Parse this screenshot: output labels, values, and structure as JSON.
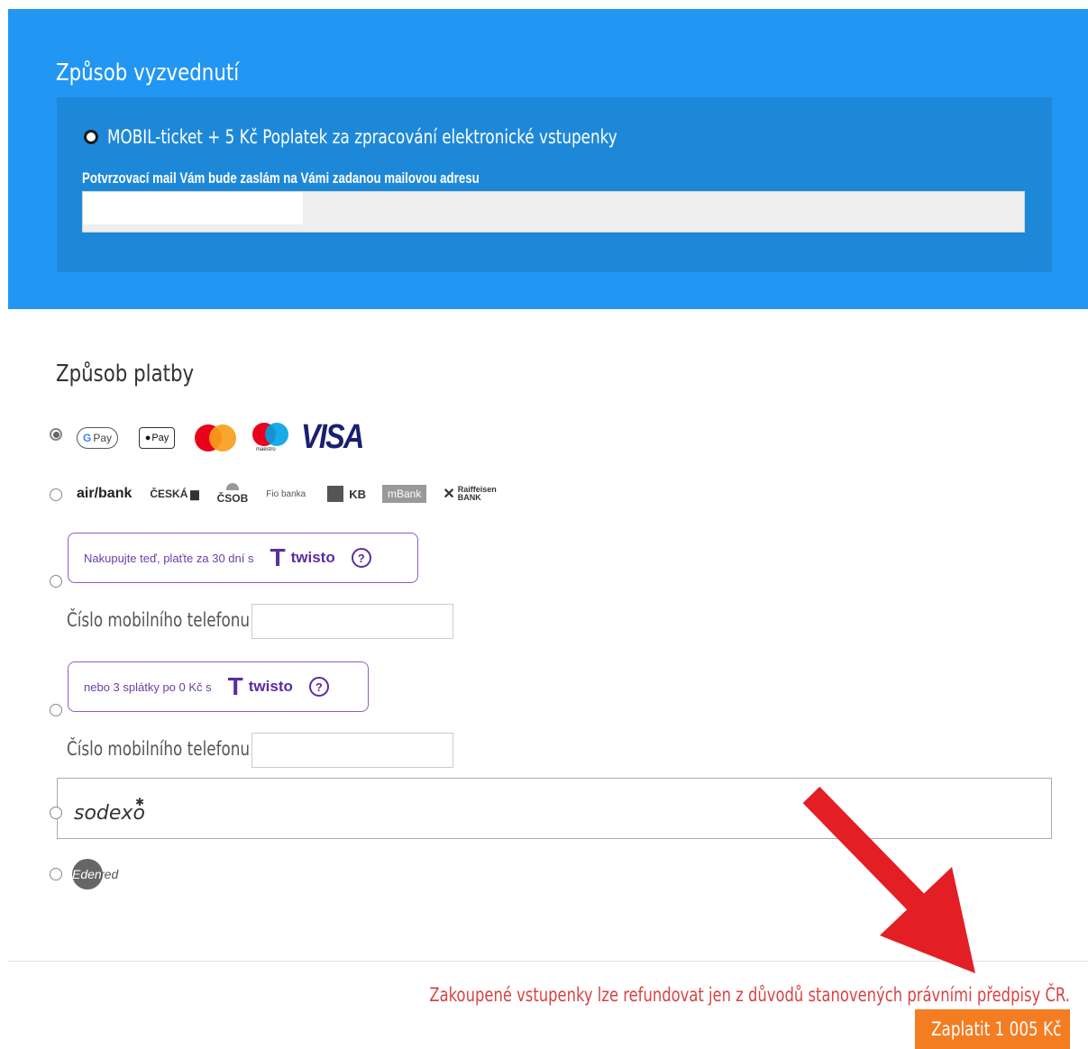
{
  "pickup": {
    "title": "Způsob vyzvednutí",
    "option_label": "MOBIL-ticket + 5 Kč Poplatek za zpracování elektronické vstupenky",
    "mail_label": "Potvrzovací mail Vám bude zaslám na Vámi zadanou mailovou adresu",
    "email_value": ""
  },
  "payment": {
    "title": "Způsob platby",
    "cards": {
      "gpay": "Pay",
      "apple_pay": "Pay",
      "maestro": "maestro",
      "visa": "VISA"
    },
    "banks": {
      "airbank": "air/bank",
      "ceska": "ČESKÁ",
      "csob": "ČSOB",
      "fio": "Fio banka",
      "kb": "KB",
      "mbank": "mBank",
      "raiffeisen_1": "Raiffeisen",
      "raiffeisen_2": "BANK"
    },
    "twisto_30": {
      "text": "Nakupujte teď, plaťte za 30 dní s",
      "brand": "twisto",
      "help": "?"
    },
    "twisto_3": {
      "text": "nebo 3 splátky po 0 Kč s",
      "brand": "twisto",
      "help": "?"
    },
    "phone_label": "Číslo mobilního telefonu:",
    "sodexo": "sodexo",
    "edenred_1": "Eden",
    "edenred_2": "red"
  },
  "footer": {
    "refund_notice": "Zakoupené vstupenky lze refundovat jen z důvodů stanovených právními předpisy ČR.",
    "pay_button": "Zaplatit 1 005 Kč"
  },
  "colors": {
    "pickup_bg": "#2196f3",
    "pay_button": "#f47c21",
    "notice": "#d84343",
    "twisto": "#5b2d9e",
    "arrow": "#e31e24"
  }
}
